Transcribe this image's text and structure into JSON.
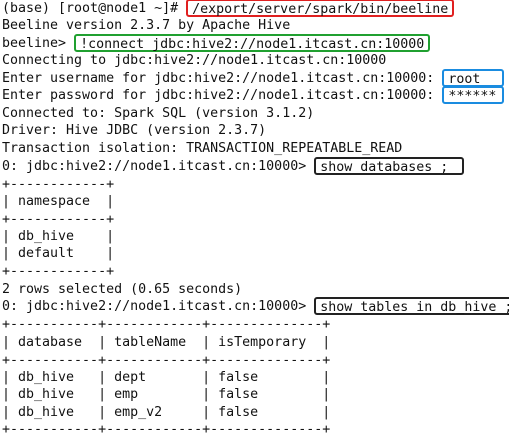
{
  "colors": {
    "background": "#ffffff",
    "text": "#111111",
    "command_highlight": "#e02020",
    "connect_highlight": "#20a030",
    "credentials_highlight": "#1a8ce0",
    "query_highlight": "#222222"
  },
  "shell": {
    "prompt": "(base) [root@node1 ~]# ",
    "command": "/export/server/spark/bin/beeline"
  },
  "beeline": {
    "version_line": "Beeline version 2.3.7 by Apache Hive",
    "prompt": "beeline> ",
    "connect_command": "!connect jdbc:hive2://node1.itcast.cn:10000",
    "connecting_line": "Connecting to jdbc:hive2://node1.itcast.cn:10000",
    "username_prompt": "Enter username for jdbc:hive2://node1.itcast.cn:10000: ",
    "username_value": "root",
    "password_prompt": "Enter password for jdbc:hive2://node1.itcast.cn:10000: ",
    "password_value": "******",
    "connected_line": "Connected to: Spark SQL (version 3.1.2)",
    "driver_line": "Driver: Hive JDBC (version 2.3.7)",
    "isolation_line": "Transaction isolation: TRANSACTION_REPEATABLE_READ",
    "session_prompt": "0: jdbc:hive2://node1.itcast.cn:10000> "
  },
  "query1": {
    "command": "show databases ;",
    "border": "+------------+",
    "header_row": "| namespace  |",
    "rows": [
      "| db_hive    |",
      "| default    |"
    ],
    "summary": "2 rows selected (0.65 seconds)"
  },
  "query2": {
    "command": "show tables in db_hive ;",
    "border": "+-----------+------------+--------------+",
    "header_row": "| database  | tableName  | isTemporary  |",
    "rows": [
      "| db_hive   | dept       | false        |",
      "| db_hive   | emp        | false        |",
      "| db_hive   | emp_v2     | false        |"
    ]
  }
}
